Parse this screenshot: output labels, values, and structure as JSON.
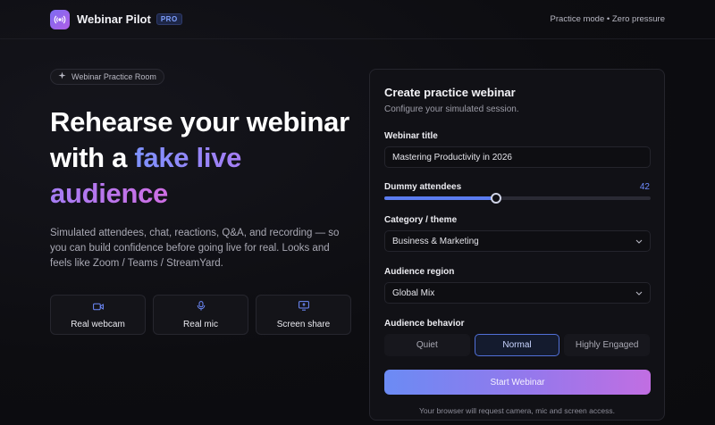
{
  "topbar": {
    "brand": "Webinar Pilot",
    "badge": "PRO",
    "status": "Practice mode • Zero pressure"
  },
  "hero": {
    "pill": "Webinar Practice Room",
    "line1": "Rehearse your webinar",
    "line2_prefix": "with a ",
    "line2_highlight": "fake live audience",
    "description": "Simulated attendees, chat, reactions, Q&A, and recording — so you can build confidence before going live for real. Looks and feels like Zoom / Teams / StreamYard.",
    "features": [
      {
        "label": "Real webcam",
        "icon": "camera-icon"
      },
      {
        "label": "Real mic",
        "icon": "mic-icon"
      },
      {
        "label": "Screen share",
        "icon": "monitor-icon"
      }
    ]
  },
  "form": {
    "title": "Create practice webinar",
    "subtitle": "Configure your simulated session.",
    "webinar_title_label": "Webinar title",
    "webinar_title_value": "Mastering Productivity in 2026",
    "attendees_label": "Dummy attendees",
    "attendees_value": "42",
    "attendees_fraction": 0.42,
    "category_label": "Category / theme",
    "category_value": "Business & Marketing",
    "region_label": "Audience region",
    "region_value": "Global Mix",
    "behavior_label": "Audience behavior",
    "behavior_options": [
      "Quiet",
      "Normal",
      "Highly Engaged"
    ],
    "behavior_selected": "Normal",
    "start_label": "Start Webinar",
    "note": "Your browser will request camera, mic and screen access."
  },
  "colors": {
    "accent": "#5b7cf0",
    "gradient_start": "#6b8bf4",
    "gradient_end": "#c16ee2",
    "background": "#0d0d11"
  }
}
